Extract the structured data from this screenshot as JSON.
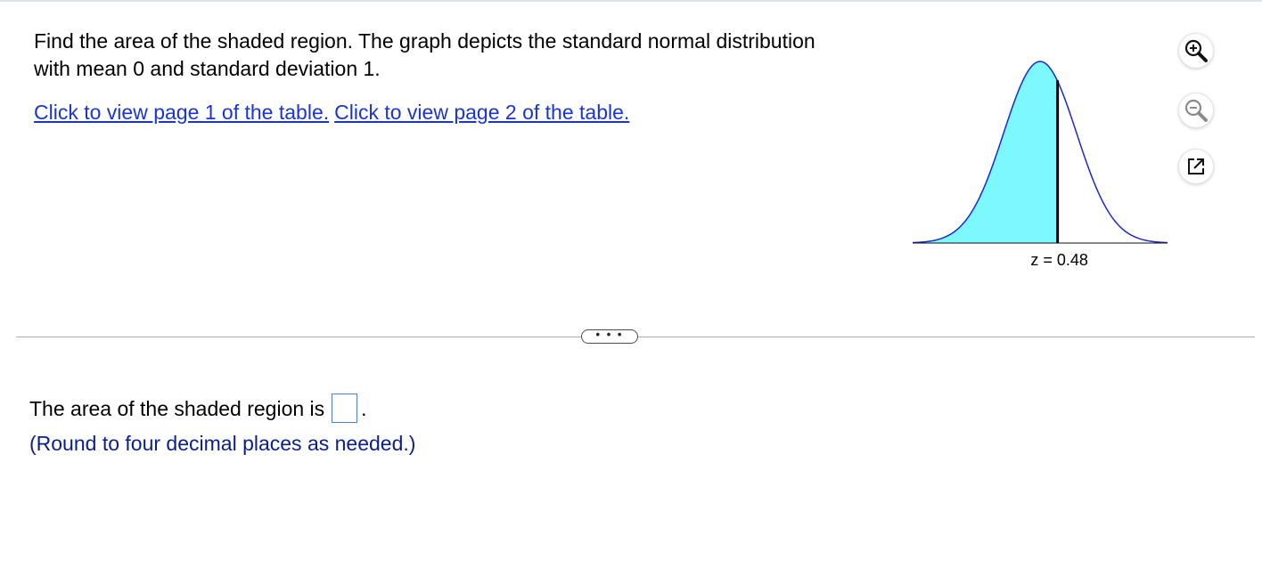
{
  "question": {
    "text": "Find the area of the shaded region. The graph depicts the standard normal distribution with mean 0 and standard deviation 1."
  },
  "links": [
    {
      "label": "Click to view page 1 of the table."
    },
    {
      "label": "Click to view page 2 of the table."
    }
  ],
  "graph": {
    "z_label": "z = 0.48",
    "z_value": 0.48,
    "shaded_side": "left",
    "shade_color": "#7ef8ff",
    "curve_color": "#1a28d6"
  },
  "toolbar": {
    "zoom_in_icon": "zoom-in-icon",
    "zoom_out_icon": "zoom-out-icon",
    "popout_icon": "popout-icon"
  },
  "divider": {
    "more_label": "• • •"
  },
  "answer": {
    "prefix": "The area of the shaded region is",
    "suffix": ".",
    "value": "",
    "hint": "(Round to four decimal places as needed.)"
  }
}
